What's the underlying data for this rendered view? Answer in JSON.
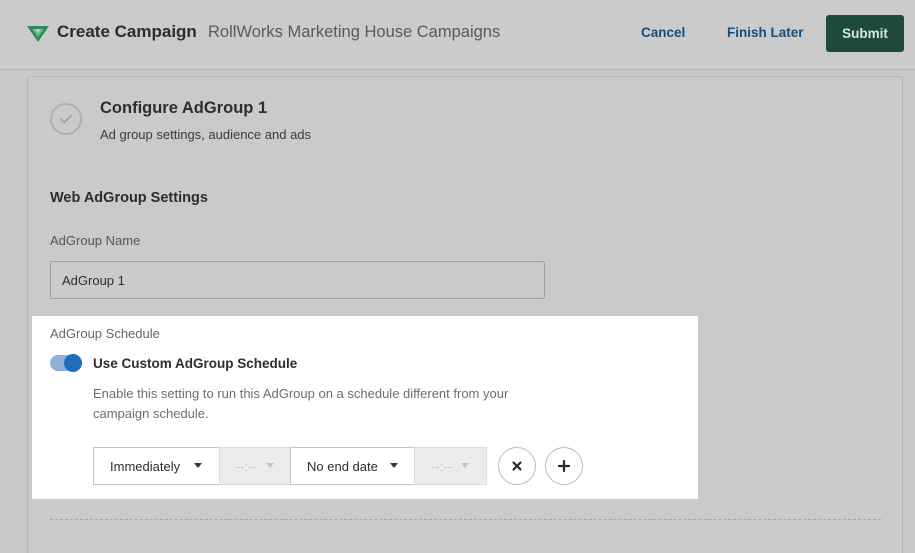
{
  "header": {
    "title": "Create Campaign",
    "campaign_name": "RollWorks Marketing House Campaigns",
    "cancel_label": "Cancel",
    "finish_later_label": "Finish Later",
    "submit_label": "Submit"
  },
  "step": {
    "title": "Configure AdGroup 1",
    "subtitle": "Ad group settings, audience and ads",
    "status_icon": "check-icon"
  },
  "settings": {
    "section_title": "Web AdGroup Settings",
    "name_label": "AdGroup Name",
    "name_value": "AdGroup 1"
  },
  "schedule": {
    "label": "AdGroup Schedule",
    "toggle_on": true,
    "toggle_label": "Use Custom AdGroup Schedule",
    "help_text": "Enable this setting to run this AdGroup on a schedule different from your campaign schedule.",
    "start_option": "Immediately",
    "start_time": "--:--",
    "end_option": "No end date",
    "end_time": "--:--",
    "remove_icon": "close-icon",
    "add_icon": "plus-icon"
  },
  "colors": {
    "primary_dark_green": "#1d4a3b",
    "link_blue": "#174d7a",
    "toggle_blue": "#1f6dbd",
    "brand_green": "#2e8a57"
  }
}
